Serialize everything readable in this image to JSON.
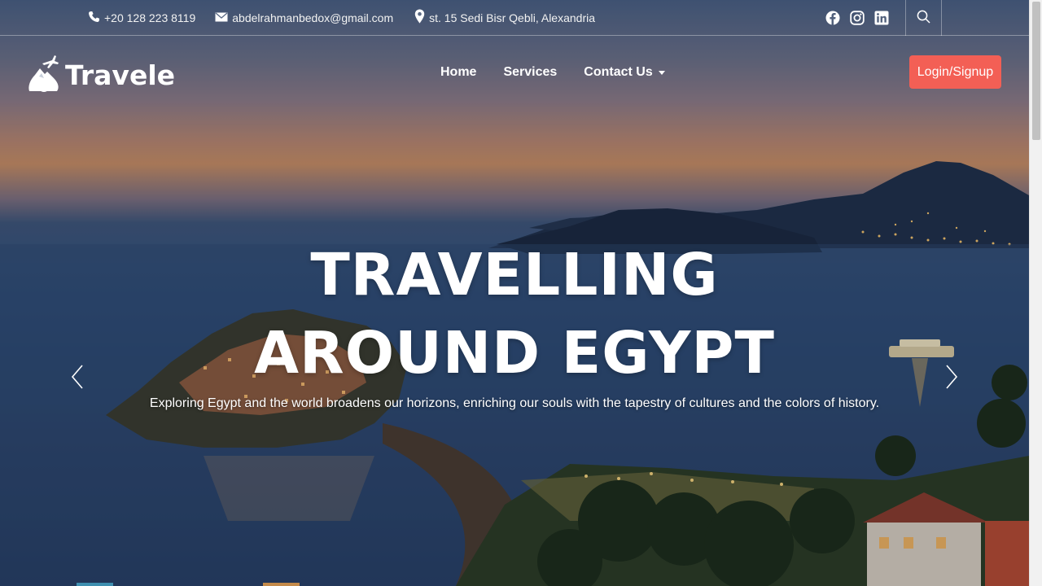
{
  "topbar": {
    "phone": "+20 128 223 8119",
    "email": "abdelrahmanbedox@gmail.com",
    "address": "st. 15 Sedi Bisr Qebli, Alexandria",
    "social_icons": [
      "facebook-icon",
      "instagram-icon",
      "linkedin-icon"
    ],
    "search_icon": "search-icon"
  },
  "navbar": {
    "logo_text": "Travele",
    "links": [
      {
        "label": "Home"
      },
      {
        "label": "Services"
      },
      {
        "label": "Contact Us"
      }
    ],
    "login_label": "Login/Signup"
  },
  "hero": {
    "headline_line1": "TRAVELLING",
    "headline_line2": "AROUND EGYPT",
    "subtitle": "Exploring Egypt and the world broadens our horizons, enriching our souls with the tapestry of cultures and the colors of history."
  },
  "colors": {
    "accent": "#f35f55",
    "text": "#ffffff"
  }
}
